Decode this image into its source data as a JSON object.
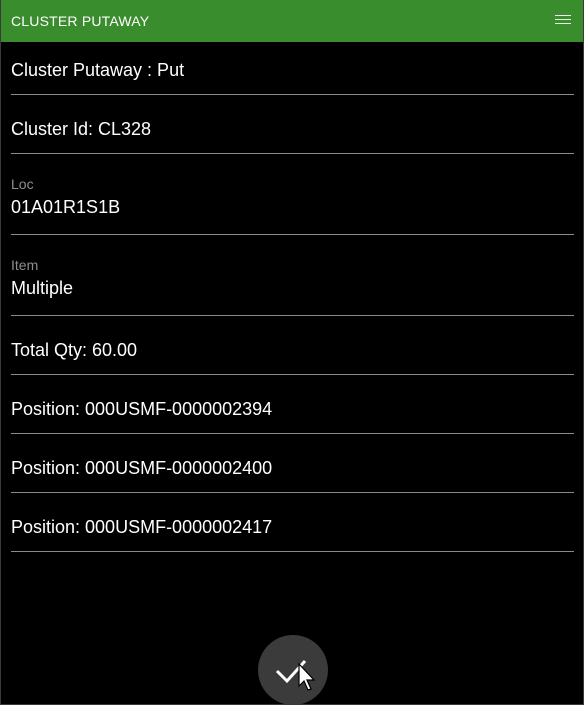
{
  "header": {
    "title": "CLUSTER PUTAWAY",
    "accent_color": "#3a8d2d",
    "menu_icon": "hamburger-menu-icon"
  },
  "fields": {
    "step": "Cluster Putaway : Put",
    "cluster_id": "Cluster Id: CL328",
    "loc_label": "Loc",
    "loc_value": "01A01R1S1B",
    "item_label": "Item",
    "item_value": "Multiple",
    "total_qty": "Total Qty: 60.00",
    "positions": [
      "Position: 000USMF-0000002394",
      "Position: 000USMF-0000002400",
      "Position: 000USMF-0000002417"
    ]
  },
  "actions": {
    "confirm_icon": "checkmark-icon"
  }
}
